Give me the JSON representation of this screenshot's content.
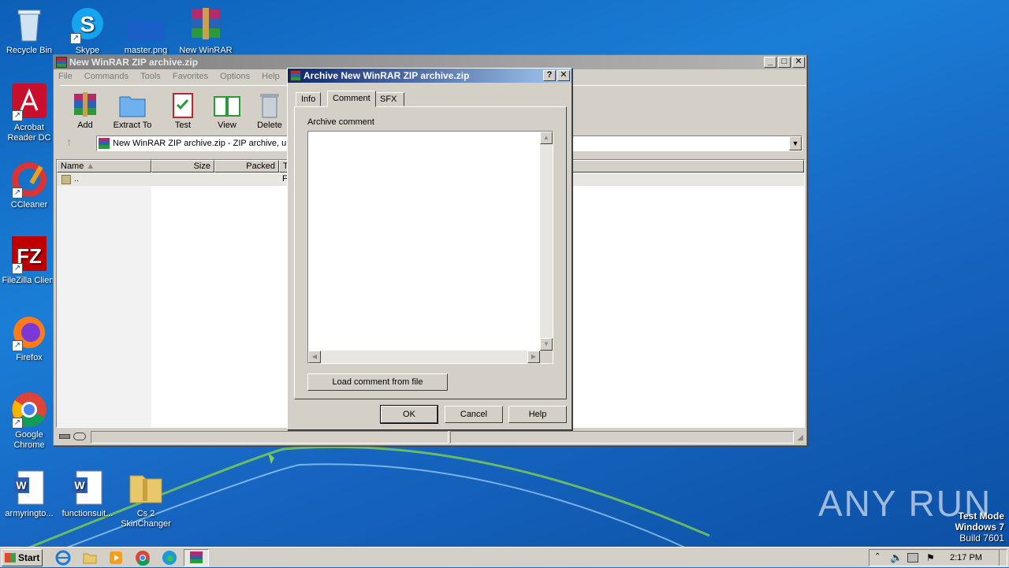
{
  "desktop": {
    "icons": [
      {
        "label": "Recycle Bin"
      },
      {
        "label": "Skype"
      },
      {
        "label": "master.png"
      },
      {
        "label": "New WinRAR"
      },
      {
        "label": "Acrobat Reader DC"
      },
      {
        "label": "CCleaner"
      },
      {
        "label": "FileZilla Client"
      },
      {
        "label": "Firefox"
      },
      {
        "label": "Google Chrome"
      },
      {
        "label": "armyringto..."
      },
      {
        "label": "functionsuit..."
      },
      {
        "label": "Cs 2 SkinChanger"
      }
    ],
    "watermark": {
      "brand": "ANY RUN",
      "line1": "Test Mode",
      "line2": "Windows 7",
      "line3": "Build 7601"
    }
  },
  "winrar": {
    "title": "New WinRAR ZIP archive.zip",
    "menu": [
      "File",
      "Commands",
      "Tools",
      "Favorites",
      "Options",
      "Help"
    ],
    "toolbar": [
      {
        "label": "Add",
        "icon": "add-icon"
      },
      {
        "label": "Extract To",
        "icon": "extract-folder-icon"
      },
      {
        "label": "Test",
        "icon": "test-clipboard-icon"
      },
      {
        "label": "View",
        "icon": "view-book-icon"
      },
      {
        "label": "Delete",
        "icon": "trash-icon"
      }
    ],
    "path": "New WinRAR ZIP archive.zip - ZIP archive, un",
    "columns": {
      "name": "Name",
      "size": "Size",
      "packed": "Packed",
      "type": "T"
    },
    "rows": [
      {
        "name": "..",
        "type": "F"
      }
    ]
  },
  "dialog": {
    "title": "Archive New WinRAR ZIP archive.zip",
    "help_btn": "?",
    "close_btn": "✕",
    "tabs": [
      "Info",
      "Comment",
      "SFX"
    ],
    "active_tab": "Comment",
    "comment_label": "Archive comment",
    "comment_value": "",
    "load_button": "Load comment from file",
    "ok": "OK",
    "cancel": "Cancel",
    "help": "Help"
  },
  "taskbar": {
    "start": "Start",
    "clock": "2:17 PM",
    "icons": [
      "ie-icon",
      "explorer-icon",
      "media-player-icon",
      "chrome-icon",
      "edge-icon",
      "winrar-icon"
    ]
  }
}
